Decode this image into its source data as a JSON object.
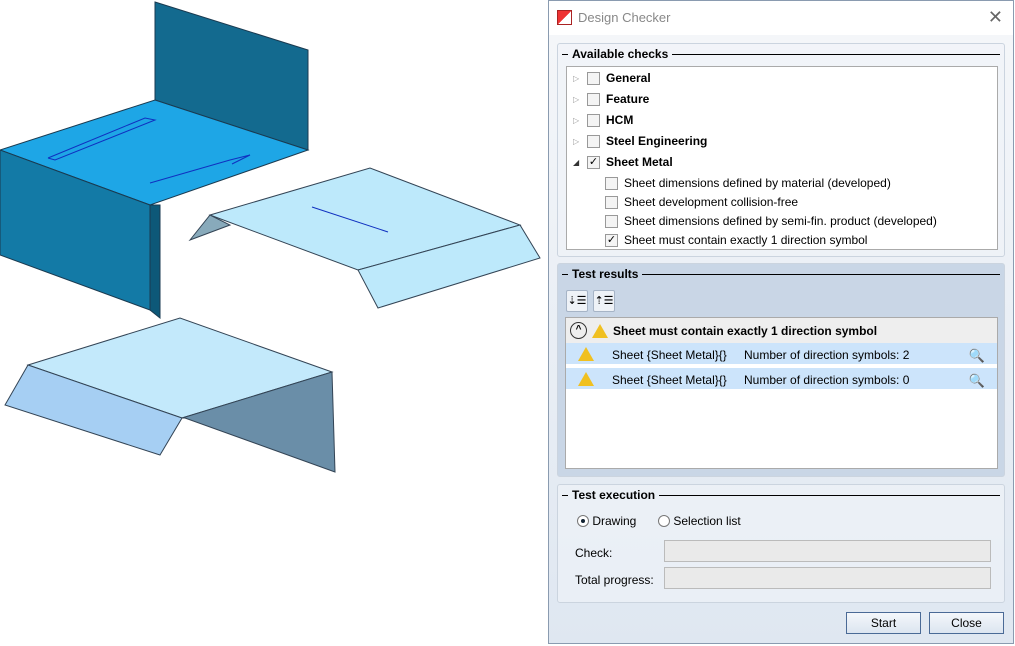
{
  "dialog": {
    "title": "Design Checker"
  },
  "available_checks": {
    "label": "Available checks",
    "items": [
      {
        "label": "General",
        "checked": false,
        "expanded": false
      },
      {
        "label": "Feature",
        "checked": false,
        "expanded": false
      },
      {
        "label": "HCM",
        "checked": false,
        "expanded": false
      },
      {
        "label": "Steel Engineering",
        "checked": false,
        "expanded": false
      },
      {
        "label": "Sheet Metal",
        "checked": true,
        "expanded": true
      }
    ],
    "sub_items": [
      {
        "label": "Sheet dimensions defined by material (developed)",
        "checked": false
      },
      {
        "label": "Sheet development collision-free",
        "checked": false
      },
      {
        "label": "Sheet dimensions defined by semi-fin. product (developed)",
        "checked": false
      },
      {
        "label": "Sheet must contain exactly 1 direction symbol",
        "checked": true
      }
    ]
  },
  "test_results": {
    "label": "Test results",
    "group_title": "Sheet must contain exactly 1 direction symbol",
    "rows": [
      {
        "object": "Sheet {Sheet Metal}{}",
        "message": "Number of direction symbols: 2"
      },
      {
        "object": "Sheet {Sheet Metal}{}",
        "message": "Number of direction symbols: 0"
      }
    ]
  },
  "test_execution": {
    "label": "Test execution",
    "options": [
      "Drawing",
      "Selection list"
    ],
    "selected": "Drawing",
    "check_label": "Check:",
    "progress_label": "Total progress:",
    "check_value": "",
    "progress_value": ""
  },
  "buttons": {
    "start": "Start",
    "close": "Close"
  }
}
